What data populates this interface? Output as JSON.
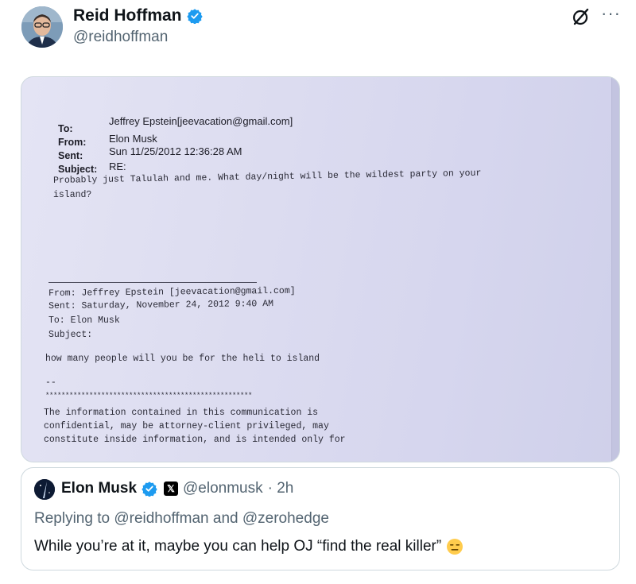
{
  "post": {
    "author": {
      "display_name": "Reid Hoffman",
      "handle": "@reidhoffman",
      "verified": true
    },
    "icons": [
      "verified-badge-icon",
      "grok-icon",
      "more-options-icon"
    ],
    "more_label": "···"
  },
  "media": {
    "email_header": {
      "to_label": "To:",
      "to_value": "Jeffrey Epstein[jeevacation@gmail.com]",
      "from_label": "From:",
      "from_value": "Elon Musk",
      "sent_label": "Sent:",
      "sent_value": "Sun 11/25/2012 12:36:28 AM",
      "subject_label": "Subject:",
      "subject_value": "RE:"
    },
    "reply_body": [
      "Probably just Talulah and me.  What day/night will be the wildest party on your",
      "island?"
    ],
    "quoted_header": [
      "From: Jeffrey Epstein [jeevacation@gmail.com]",
      "Sent: Saturday, November 24, 2012 9:40 AM",
      "To: Elon Musk",
      "Subject:"
    ],
    "quoted_body": "how many people will you be for the heli to island",
    "signature_dashes": "--",
    "asterisks": "****************************************************",
    "disclaimer": [
      "The information contained in this communication is",
      "confidential, may be attorney-client privileged, may",
      "constitute inside information, and is intended only for"
    ]
  },
  "quote_post": {
    "author": {
      "display_name": "Elon Musk",
      "handle": "@elonmusk",
      "time": "· 2h",
      "verified": true,
      "affiliate_badge": "𝕏"
    },
    "replying_to": "Replying to @reidhoffman and @zerohedge",
    "text": "While you’re at it, maybe you can help OJ “find the real killer”",
    "emoji": "expressionless-face-emoji"
  },
  "colors": {
    "text_primary": "#0f1419",
    "text_secondary": "#536471",
    "verified_blue": "#1d9bf0",
    "border": "#cfd9de",
    "paper": "#dcdcf0"
  }
}
